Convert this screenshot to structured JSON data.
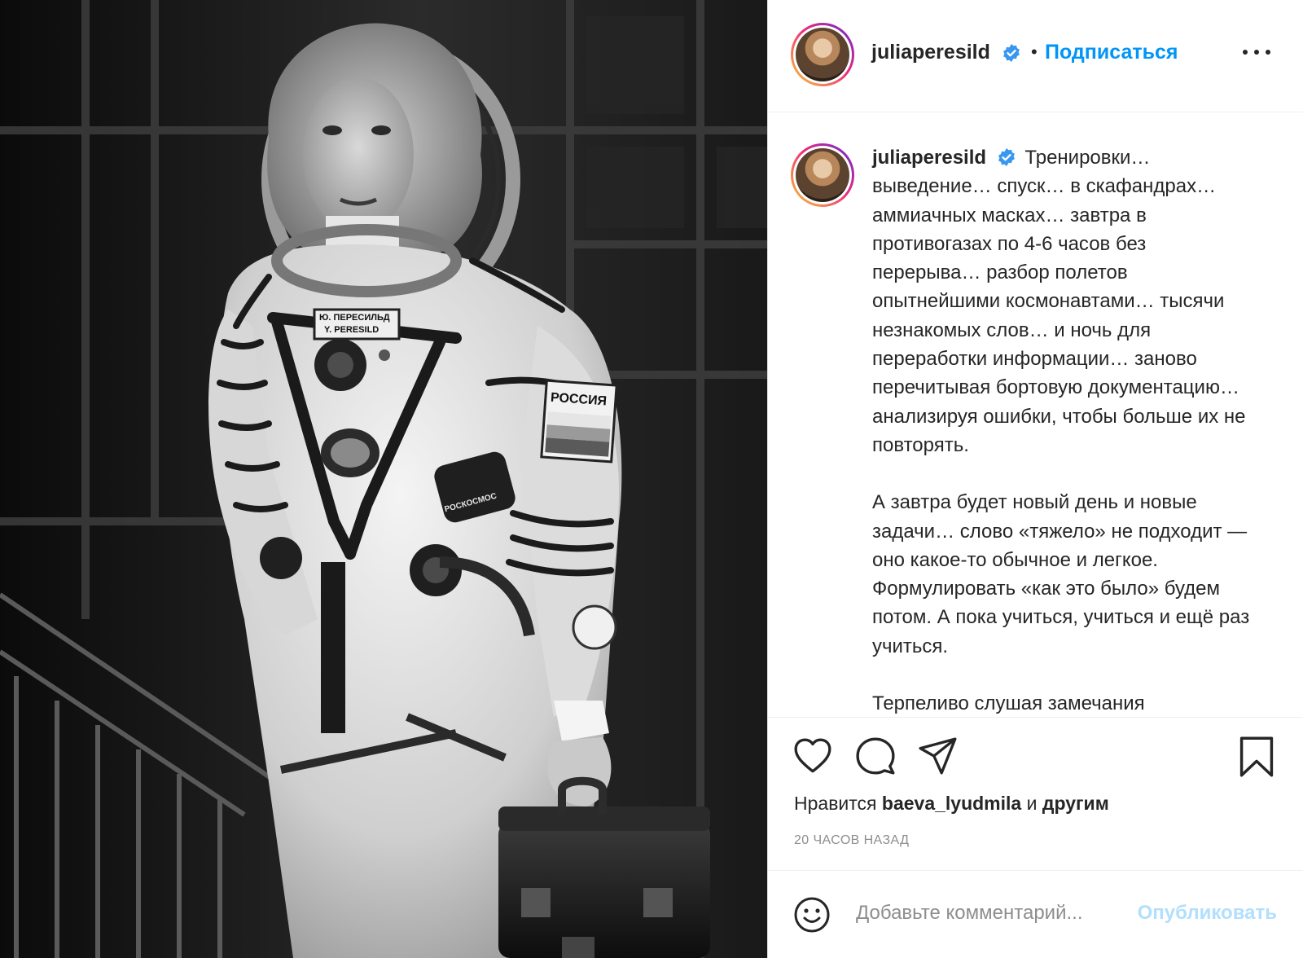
{
  "photo": {
    "patch_name_ru": "Ю. ПЕРЕСИЛЬД",
    "patch_name_en": "Y. PERESILD",
    "patch_country": "РОССИЯ",
    "patch_agency": "РОСКОСМОС"
  },
  "header": {
    "username": "juliaperesild",
    "separator": "•",
    "follow_label": "Подписаться",
    "verified_icon": "verified-badge-icon",
    "more_icon": "more-options-icon"
  },
  "caption": {
    "username": "juliaperesild",
    "paragraph_1": "Тренировки… выведение… спуск… в скафандрах… аммиачных масках… завтра в противогазах по 4-6 часов без перерыва… разбор полетов опытнейшими космонавтами… тысячи незнакомых слов… и ночь для переработки информации… заново перечитывая бортовую документацию… анализируя ошибки, чтобы больше их не повторять.",
    "paragraph_2": "А завтра будет новый день и новые задачи… слово «тяжело» не подходит — оно какое-то обычное и легкое. Формулировать «как это было» будем потом. А пока учиться, учиться и ещё раз учиться.",
    "paragraph_3": "Терпеливо слушая замечания"
  },
  "actions": {
    "like_icon": "heart-icon",
    "comment_icon": "comment-bubble-icon",
    "share_icon": "paper-plane-icon",
    "save_icon": "bookmark-icon",
    "likes_prefix": "Нравится",
    "likes_user": "baeva_lyudmila",
    "likes_and": "и",
    "likes_suffix": "другим",
    "timestamp": "20 ЧАСОВ НАЗАД"
  },
  "comment_bar": {
    "emoji_icon": "smiley-icon",
    "placeholder": "Добавьте комментарий...",
    "publish_label": "Опубликовать"
  },
  "colors": {
    "link_blue": "#0095f6",
    "publish_disabled": "#b2dffc",
    "muted_gray": "#8e8e8e",
    "text": "#262626"
  }
}
